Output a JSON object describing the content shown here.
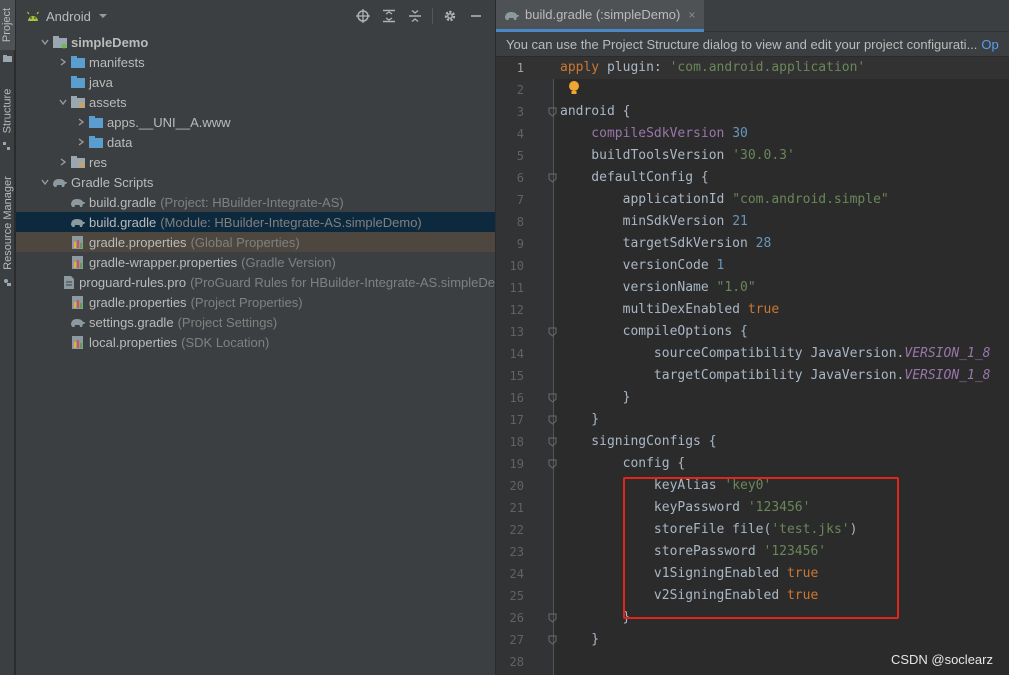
{
  "left_stripe": {
    "tabs": [
      "Project",
      "Structure",
      "Resource Manager"
    ]
  },
  "project_panel": {
    "view_selector": "Android",
    "tree": [
      {
        "name": "simpleDemo",
        "hint": "",
        "icon": "module-folder-icon",
        "arrow": "down"
      },
      {
        "name": "manifests",
        "hint": "",
        "icon": "folder-icon",
        "arrow": "right"
      },
      {
        "name": "java",
        "hint": "",
        "icon": "folder-icon",
        "arrow": ""
      },
      {
        "name": "assets",
        "hint": "",
        "icon": "assets-folder-icon",
        "arrow": "down"
      },
      {
        "name": "apps.__UNI__A.www",
        "hint": "",
        "icon": "folder-icon",
        "arrow": "right"
      },
      {
        "name": "data",
        "hint": "",
        "icon": "folder-icon",
        "arrow": "right"
      },
      {
        "name": "res",
        "hint": "",
        "icon": "res-folder-icon",
        "arrow": "right"
      },
      {
        "name": "Gradle Scripts",
        "hint": "",
        "icon": "gradle-icon",
        "arrow": "down"
      },
      {
        "name": "build.gradle",
        "hint": "(Project: HBuilder-Integrate-AS)",
        "icon": "gradle-icon",
        "arrow": ""
      },
      {
        "name": "build.gradle",
        "hint": "(Module: HBuilder-Integrate-AS.simpleDemo)",
        "icon": "gradle-icon",
        "arrow": ""
      },
      {
        "name": "gradle.properties",
        "hint": "(Global Properties)",
        "icon": "properties-icon",
        "arrow": ""
      },
      {
        "name": "gradle-wrapper.properties",
        "hint": "(Gradle Version)",
        "icon": "properties-icon",
        "arrow": ""
      },
      {
        "name": "proguard-rules.pro",
        "hint": "(ProGuard Rules for HBuilder-Integrate-AS.simpleDe",
        "icon": "file-icon",
        "arrow": ""
      },
      {
        "name": "gradle.properties",
        "hint": "(Project Properties)",
        "icon": "properties-icon",
        "arrow": ""
      },
      {
        "name": "settings.gradle",
        "hint": "(Project Settings)",
        "icon": "gradle-icon",
        "arrow": ""
      },
      {
        "name": "local.properties",
        "hint": "(SDK Location)",
        "icon": "properties-icon",
        "arrow": ""
      }
    ]
  },
  "editor": {
    "tab_label": "build.gradle (:simpleDemo)",
    "tab_close": "×",
    "banner_text": "You can use the Project Structure dialog to view and edit your project configurati...",
    "banner_link": "Op",
    "lines": [
      {
        "n": "1",
        "tokens": [
          [
            "kw",
            "apply "
          ],
          [
            "plain",
            "plugin: "
          ],
          [
            "str",
            "'com.android.application'"
          ]
        ]
      },
      {
        "n": "2",
        "tokens": []
      },
      {
        "n": "3",
        "tokens": [
          [
            "plain",
            "android {"
          ]
        ]
      },
      {
        "n": "4",
        "tokens": [
          [
            "prop",
            "    compileSdkVersion "
          ],
          [
            "num",
            "30"
          ]
        ]
      },
      {
        "n": "5",
        "tokens": [
          [
            "plain",
            "    buildToolsVersion "
          ],
          [
            "str",
            "'30.0.3'"
          ]
        ]
      },
      {
        "n": "6",
        "tokens": [
          [
            "plain",
            "    defaultConfig {"
          ]
        ]
      },
      {
        "n": "7",
        "tokens": [
          [
            "plain",
            "        applicationId "
          ],
          [
            "str",
            "\"com.android.simple\""
          ]
        ]
      },
      {
        "n": "8",
        "tokens": [
          [
            "plain",
            "        minSdkVersion "
          ],
          [
            "num",
            "21"
          ]
        ]
      },
      {
        "n": "9",
        "tokens": [
          [
            "plain",
            "        targetSdkVersion "
          ],
          [
            "num",
            "28"
          ]
        ]
      },
      {
        "n": "10",
        "tokens": [
          [
            "plain",
            "        versionCode "
          ],
          [
            "num",
            "1"
          ]
        ]
      },
      {
        "n": "11",
        "tokens": [
          [
            "plain",
            "        versionName "
          ],
          [
            "str",
            "\"1.0\""
          ]
        ]
      },
      {
        "n": "12",
        "tokens": [
          [
            "plain",
            "        multiDexEnabled "
          ],
          [
            "kw",
            "true"
          ]
        ]
      },
      {
        "n": "13",
        "tokens": [
          [
            "plain",
            "        compileOptions {"
          ]
        ]
      },
      {
        "n": "14",
        "tokens": [
          [
            "plain",
            "            sourceCompatibility JavaVersion."
          ],
          [
            "ital",
            "VERSION_1_8"
          ]
        ]
      },
      {
        "n": "15",
        "tokens": [
          [
            "plain",
            "            targetCompatibility JavaVersion."
          ],
          [
            "ital",
            "VERSION_1_8"
          ]
        ]
      },
      {
        "n": "16",
        "tokens": [
          [
            "plain",
            "        }"
          ]
        ]
      },
      {
        "n": "17",
        "tokens": [
          [
            "plain",
            "    }"
          ]
        ]
      },
      {
        "n": "18",
        "tokens": [
          [
            "plain",
            "    signingConfigs {"
          ]
        ]
      },
      {
        "n": "19",
        "tokens": [
          [
            "plain",
            "        config {"
          ]
        ]
      },
      {
        "n": "20",
        "tokens": [
          [
            "plain",
            "            keyAlias "
          ],
          [
            "str",
            "'key0'"
          ]
        ]
      },
      {
        "n": "21",
        "tokens": [
          [
            "plain",
            "            keyPassword "
          ],
          [
            "str",
            "'123456'"
          ]
        ]
      },
      {
        "n": "22",
        "tokens": [
          [
            "plain",
            "            storeFile file("
          ],
          [
            "str",
            "'test.jks'"
          ],
          [
            "plain",
            ")"
          ]
        ]
      },
      {
        "n": "23",
        "tokens": [
          [
            "plain",
            "            storePassword "
          ],
          [
            "str",
            "'123456'"
          ]
        ]
      },
      {
        "n": "24",
        "tokens": [
          [
            "plain",
            "            v1SigningEnabled "
          ],
          [
            "kw",
            "true"
          ]
        ]
      },
      {
        "n": "25",
        "tokens": [
          [
            "plain",
            "            v2SigningEnabled "
          ],
          [
            "kw",
            "true"
          ]
        ]
      },
      {
        "n": "26",
        "tokens": [
          [
            "plain",
            "        }"
          ]
        ]
      },
      {
        "n": "27",
        "tokens": [
          [
            "plain",
            "    }"
          ]
        ]
      },
      {
        "n": "28",
        "tokens": []
      }
    ]
  },
  "watermark": "CSDN @soclearz",
  "colors": {
    "selection": "#0d293e",
    "highlight": "#4d4740",
    "annotation_box": "#e0261b",
    "keyword": "#cc7832",
    "string": "#6a8759",
    "number": "#6897bb"
  }
}
